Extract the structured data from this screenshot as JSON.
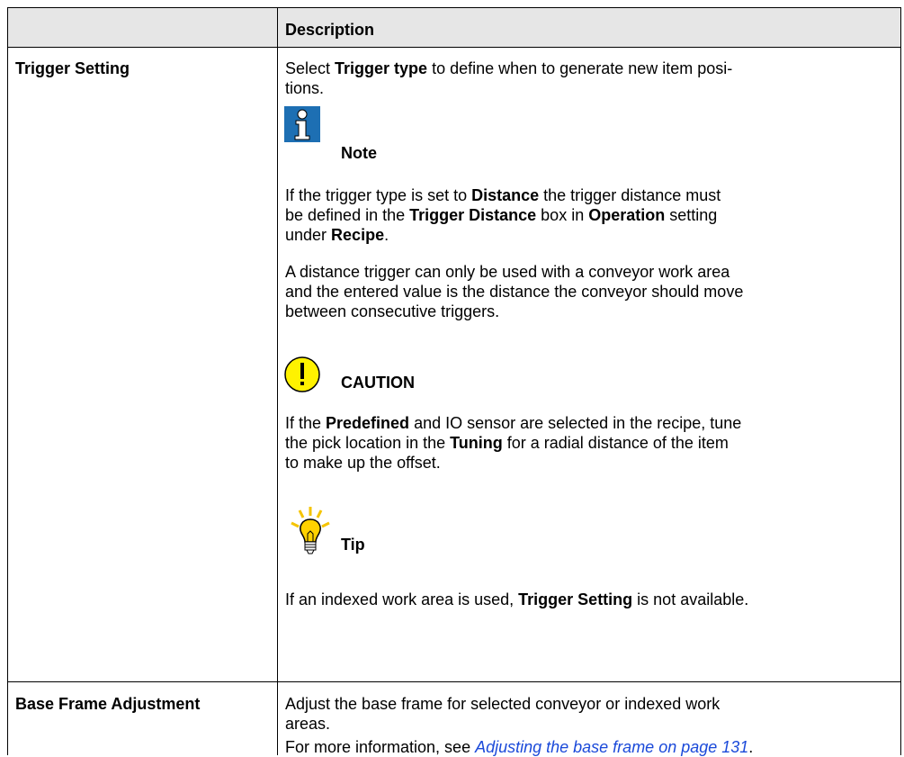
{
  "header": {
    "description": "Description"
  },
  "rows": [
    {
      "label": "Trigger Setting",
      "intro": [
        "Select ",
        "Trigger type",
        " to define when to generate new item posi-",
        "tions."
      ],
      "note": {
        "title": "Note",
        "icon": "info-icon",
        "text": [
          "If the trigger type is set to ",
          "Distance",
          " the trigger distance must",
          "be defined in the ",
          "Trigger Distance",
          " box in ",
          "Operation",
          " setting",
          "under ",
          "Recipe",
          "."
        ]
      },
      "distance_text": [
        "A distance trigger can only be used with a conveyor work area",
        "and the entered value is the distance the conveyor should move",
        "between consecutive triggers."
      ],
      "caution": {
        "title": "CAUTION",
        "icon": "caution-icon",
        "text": [
          "If the ",
          "Predefined",
          " and IO sensor are selected in the recipe, tune",
          "the pick location in the ",
          "Tuning",
          " for a radial distance of the item",
          "to make up the offset."
        ]
      },
      "tip": {
        "title": "Tip",
        "icon": "lightbulb-icon",
        "text": [
          "If an indexed work area is used, ",
          "Trigger Setting",
          " is not available."
        ]
      }
    },
    {
      "label": "Base Frame Adjustment",
      "lines": [
        "Adjust the base frame for selected conveyor or indexed work",
        "areas."
      ],
      "more_prefix": "For more information, see ",
      "link": "Adjusting the base frame on page 131",
      "more_suffix": "."
    }
  ],
  "colors": {
    "header_bg": "#e6e6e6",
    "info_blue": "#1d6fb3",
    "caution_yellow": "#fff200",
    "tip_yellow": "#ffd200",
    "link_blue": "#1a49d9"
  }
}
